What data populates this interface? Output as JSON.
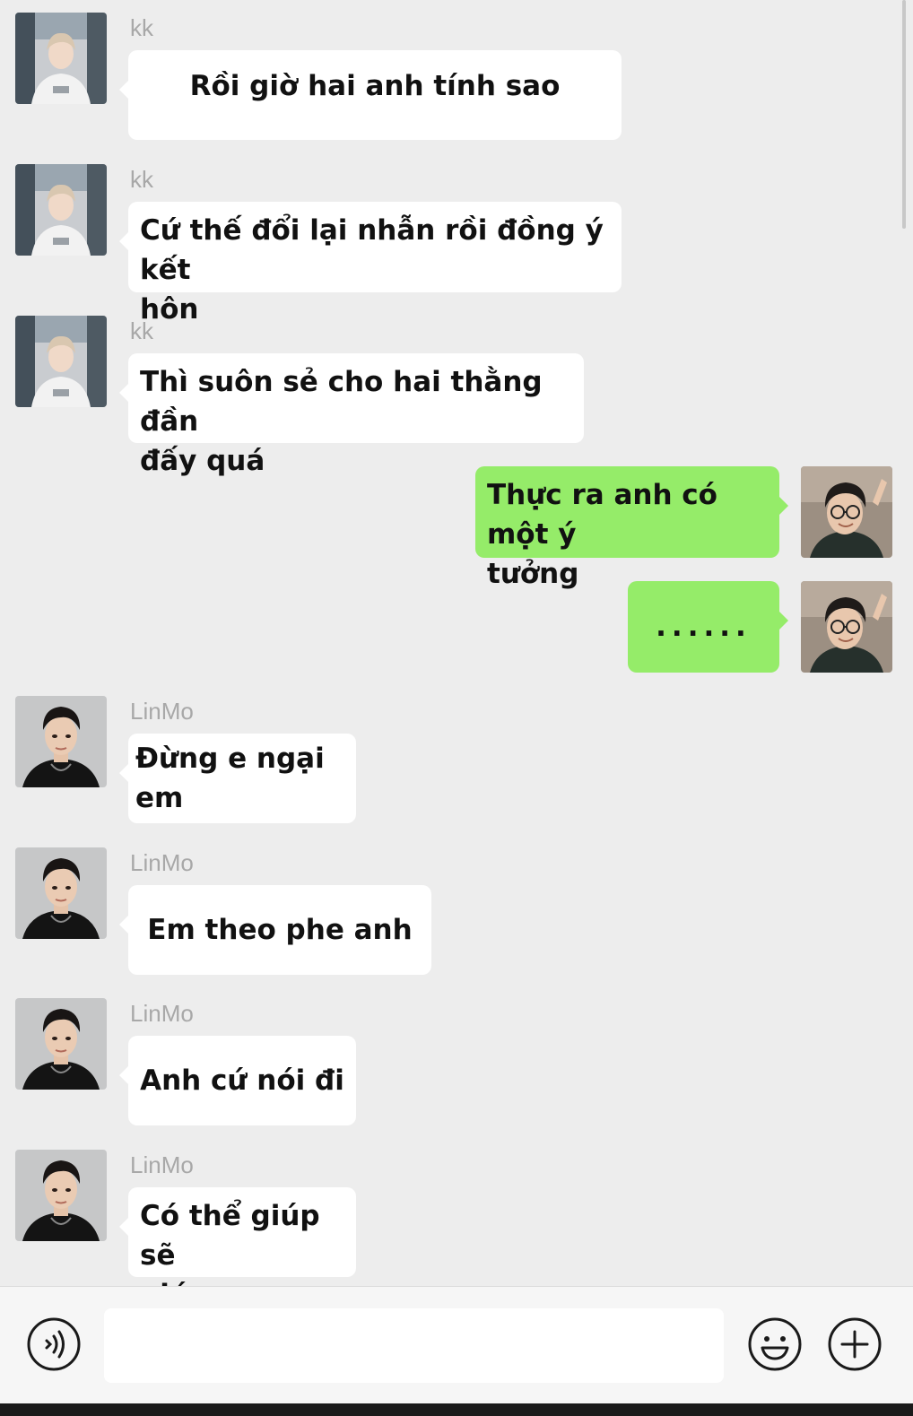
{
  "messages": [
    {
      "side": "left",
      "sender": "kk",
      "avatar": "kk-avatar",
      "lines": [
        "Rồi giờ hai anh tính sao"
      ]
    },
    {
      "side": "left",
      "sender": "kk",
      "avatar": "kk-avatar",
      "lines": [
        "Cứ thế đổi lại nhẫn rồi đồng ý kết",
        "hôn"
      ]
    },
    {
      "side": "left",
      "sender": "kk",
      "avatar": "kk-avatar",
      "lines": [
        "Thì suôn sẻ cho hai thằng đần",
        "đấy quá"
      ]
    },
    {
      "side": "right",
      "sender": "",
      "avatar": "self-avatar",
      "lines": [
        "Thực ra anh có một ý",
        "tưởng"
      ]
    },
    {
      "side": "right",
      "sender": "",
      "avatar": "self-avatar",
      "lines": [
        "......"
      ]
    },
    {
      "side": "left",
      "sender": "LinMo",
      "avatar": "linmo-avatar",
      "lines": [
        "Đừng e ngại em"
      ]
    },
    {
      "side": "left",
      "sender": "LinMo",
      "avatar": "linmo-avatar",
      "lines": [
        "Em theo phe anh"
      ]
    },
    {
      "side": "left",
      "sender": "LinMo",
      "avatar": "linmo-avatar",
      "lines": [
        "Anh cứ nói đi"
      ]
    },
    {
      "side": "left",
      "sender": "LinMo",
      "avatar": "linmo-avatar",
      "lines": [
        "Có thể giúp sẽ",
        "giúp"
      ]
    }
  ],
  "input_bar": {
    "voice_icon": "voice-icon",
    "input_value": "",
    "emoji_icon": "emoji-icon",
    "plus_icon": "plus-icon"
  },
  "colors": {
    "background": "#ededed",
    "incoming_bubble": "#ffffff",
    "outgoing_bubble": "#95ec69",
    "sender_name": "#a8a8a8",
    "text": "#111111"
  }
}
